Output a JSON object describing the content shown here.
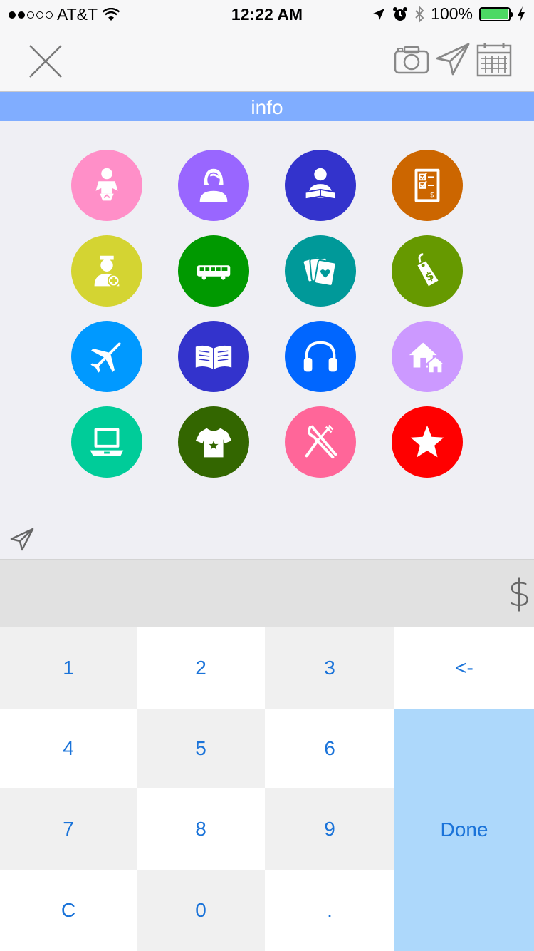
{
  "status_bar": {
    "carrier": "AT&T",
    "time": "12:22 AM",
    "battery": "100%",
    "signal_bars": 2,
    "battery_fill_fraction": 1.0,
    "battery_color": "#4cd964"
  },
  "nav": {
    "close_icon": "close-x-icon",
    "actions": [
      "camera-icon",
      "send-icon",
      "calendar-icon"
    ]
  },
  "banner": {
    "label": "info",
    "color": "#80adff"
  },
  "categories": [
    {
      "name": "baby",
      "icon": "baby-icon",
      "color": "#ff8fc8"
    },
    {
      "name": "woman",
      "icon": "woman-icon",
      "color": "#9966ff"
    },
    {
      "name": "reading",
      "icon": "reading-person-icon",
      "color": "#3333cc"
    },
    {
      "name": "checklist",
      "icon": "checklist-icon",
      "color": "#cc6600"
    },
    {
      "name": "medical",
      "icon": "nurse-icon",
      "color": "#d4d432"
    },
    {
      "name": "bus",
      "icon": "bus-icon",
      "color": "#009900"
    },
    {
      "name": "cards",
      "icon": "playing-cards-icon",
      "color": "#009999"
    },
    {
      "name": "price-tag",
      "icon": "price-tag-icon",
      "color": "#669900"
    },
    {
      "name": "travel",
      "icon": "airplane-icon",
      "color": "#0099ff"
    },
    {
      "name": "books",
      "icon": "open-book-icon",
      "color": "#3333cc"
    },
    {
      "name": "music",
      "icon": "headphones-icon",
      "color": "#0066ff"
    },
    {
      "name": "housing",
      "icon": "houses-icon",
      "color": "#cc99ff"
    },
    {
      "name": "computer",
      "icon": "laptop-icon",
      "color": "#00cc99"
    },
    {
      "name": "clothing",
      "icon": "tshirt-icon",
      "color": "#336600"
    },
    {
      "name": "food",
      "icon": "fork-knife-icon",
      "color": "#ff6699"
    },
    {
      "name": "favorite",
      "icon": "star-icon",
      "color": "#ff0000"
    }
  ],
  "amount": {
    "value": "",
    "currency": "$"
  },
  "keypad": {
    "keys": [
      "1",
      "2",
      "3",
      "<-",
      "4",
      "5",
      "6",
      "7",
      "8",
      "9",
      "C",
      "0",
      "."
    ],
    "done_label": "Done"
  },
  "colors": {
    "key_text": "#1a73d9",
    "done_bg": "#add8fb"
  }
}
